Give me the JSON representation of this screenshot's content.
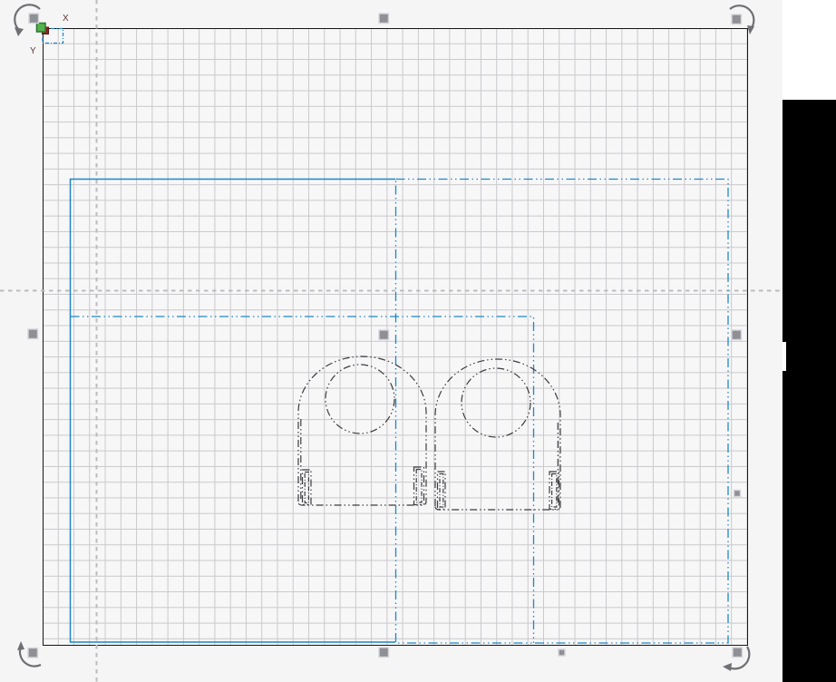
{
  "axes": {
    "x_label": "X",
    "y_label": "Y"
  },
  "colors": {
    "selection_blue": "#1f87c5",
    "drawing_stroke": "#3d3d40",
    "guide_gray": "#bcbcbe",
    "grid_line": "#c9c9cd",
    "canvas_bg": "#f7f7f8",
    "workspace_bg": "#f5f5f6",
    "canvas_border": "#161616",
    "handle_fill": "#8f8f96",
    "handle_border": "#d6d6da",
    "rotate_arrow_gray": "#6f6f74",
    "origin_green_fill": "#55b24f",
    "origin_green_border": "#2d7a2d",
    "origin_red_fill": "#8f1f1f",
    "axis_label_color": "#5f3434",
    "background_panel_black": "#000000",
    "background_strip_white": "#ffffff"
  }
}
